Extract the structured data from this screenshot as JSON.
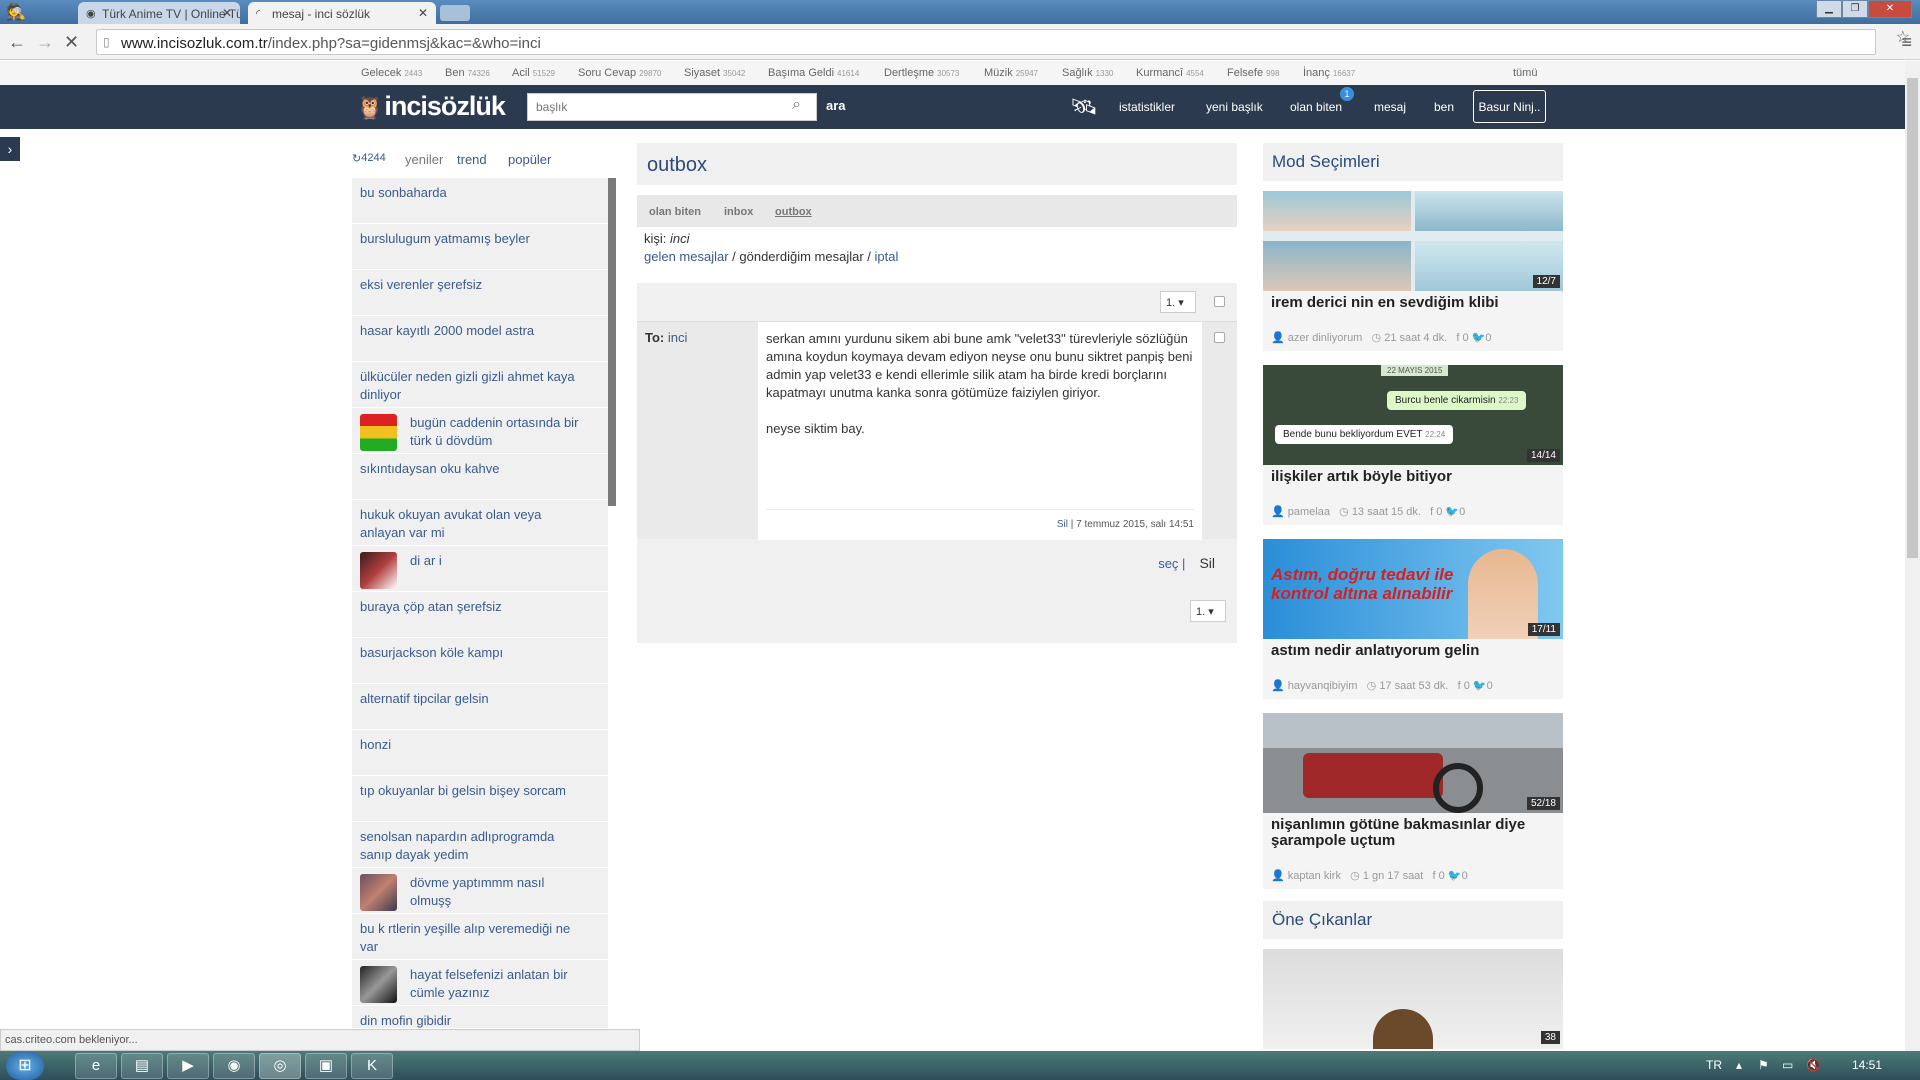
{
  "browser": {
    "tabs": [
      {
        "label": "Türk Anime TV | Online Tü"
      },
      {
        "label": "mesaj - inci sözlük"
      }
    ],
    "url_host": "www.incisozluk.com.tr",
    "url_path": "/index.php?sa=gidenmsj&kac=&who=inci",
    "status": "cas.criteo.com bekleniyor..."
  },
  "categories": [
    {
      "name": "Gelecek",
      "count": "2443"
    },
    {
      "name": "Ben",
      "count": "74326"
    },
    {
      "name": "Acil",
      "count": "51529"
    },
    {
      "name": "Soru Cevap",
      "count": "29870"
    },
    {
      "name": "Siyaset",
      "count": "35042"
    },
    {
      "name": "Başıma Geldi",
      "count": "41614"
    },
    {
      "name": "Dertleşme",
      "count": "30573"
    },
    {
      "name": "Müzik",
      "count": "25947"
    },
    {
      "name": "Sağlık",
      "count": "1330"
    },
    {
      "name": "Kurmancî",
      "count": "4554"
    },
    {
      "name": "Felsefe",
      "count": "998"
    },
    {
      "name": "İnanç",
      "count": "16637"
    }
  ],
  "categories_all": "tümü",
  "header": {
    "logo": "incisözlük",
    "search_placeholder": "başlık",
    "search_button": "ara",
    "nav": [
      "istatistikler",
      "yeni başlık",
      "olan biten",
      "mesaj",
      "ben"
    ],
    "badge": "1",
    "user": "Basur Ninj.."
  },
  "left": {
    "refresh_count": "4244",
    "tabs": [
      "yeniler",
      "trend",
      "popüler"
    ],
    "items": [
      "bu sonbaharda",
      "burslulugum yatmamış beyler",
      "eksi verenler şerefsiz",
      "hasar kayıtlı 2000 model astra",
      "ülkücüler neden gizli gizli ahmet kaya dinliyor",
      "bugün caddenin ortasında bir türk ü dövdüm",
      "sıkıntıdaysan oku kahve",
      "hukuk okuyan avukat olan veya anlayan var mi",
      "di ar i",
      "buraya çöp atan şerefsiz",
      "basurjackson köle kampı",
      "alternatif tipcilar gelsin",
      "honzi",
      "tıp okuyanlar bi gelsin bişey sorcam",
      "senolsan napardın adlıprogramda sanıp dayak yedim",
      "dövme yaptımmm nasıl olmuşş",
      "bu k rtlerin yeşille alıp veremediği ne var",
      "hayat felsefenizi anlatan bir cümle yazınız",
      "din mofin gibidir"
    ]
  },
  "main": {
    "title": "outbox",
    "subtabs": [
      "olan biten",
      "inbox",
      "outbox"
    ],
    "kisi_label": "kişi:",
    "kisi_value": "inci",
    "links": {
      "gelen": "gelen mesajlar",
      "sep1": " / ",
      "gonderdigim": "gönderdiğim mesajlar",
      "sep2": " / ",
      "iptal": "iptal"
    },
    "page": "1.",
    "message": {
      "to_label": "To:",
      "to": "inci",
      "body1": "serkan amını yurdunu sikem abi bune amk \"velet33\" türevleriyle sözlüğün amına koydun koymaya devam ediyon neyse onu bunu siktret panpiş beni admin yap velet33 e kendi ellerimle silik atam ha birde kredi borçlarını kapatmayı unutma kanka sonra götümüze faiziylen giriyor.",
      "body2": "neyse siktim bay.",
      "sil": "Sil",
      "date": "7 temmuz 2015, salı 14:51"
    },
    "sec": "seç",
    "sec_sep": "|",
    "sil_button": "Sil"
  },
  "right": {
    "mod_title": "Mod Seçimleri",
    "cards": [
      {
        "title": "irem derici nin en sevdiğim klibi",
        "count": "12/7",
        "author": "azer dinliyorum",
        "time": "21 saat 4 dk.",
        "fb": "0",
        "tw": "0"
      },
      {
        "title": "ilişkiler artık böyle bitiyor",
        "count": "14/14",
        "author": "pamelaa",
        "time": "13 saat 15 dk.",
        "fb": "0",
        "tw": "0",
        "chat": [
          "22 MAYIS 2015",
          "Burcu benle cikarmisin",
          "22:23",
          "Bende bunu bekliyordum EVET",
          "22:24"
        ]
      },
      {
        "title": "astım nedir anlatıyorum gelin",
        "count": "17/11",
        "author": "hayvanqibiyim",
        "time": "17 saat 53 dk.",
        "fb": "0",
        "tw": "0",
        "ad": "Astım, doğru tedavi ile kontrol altına alınabilir"
      },
      {
        "title": "nişanlımın götüne bakmasınlar diye şarampole uçtum",
        "count": "52/18",
        "author": "kaptan kirk",
        "time": "1 gn 17 saat",
        "fb": "0",
        "tw": "0"
      }
    ],
    "featured_title": "Öne Çıkanlar",
    "featured_count": "38"
  },
  "taskbar": {
    "lang": "TR",
    "time": "14:51"
  }
}
